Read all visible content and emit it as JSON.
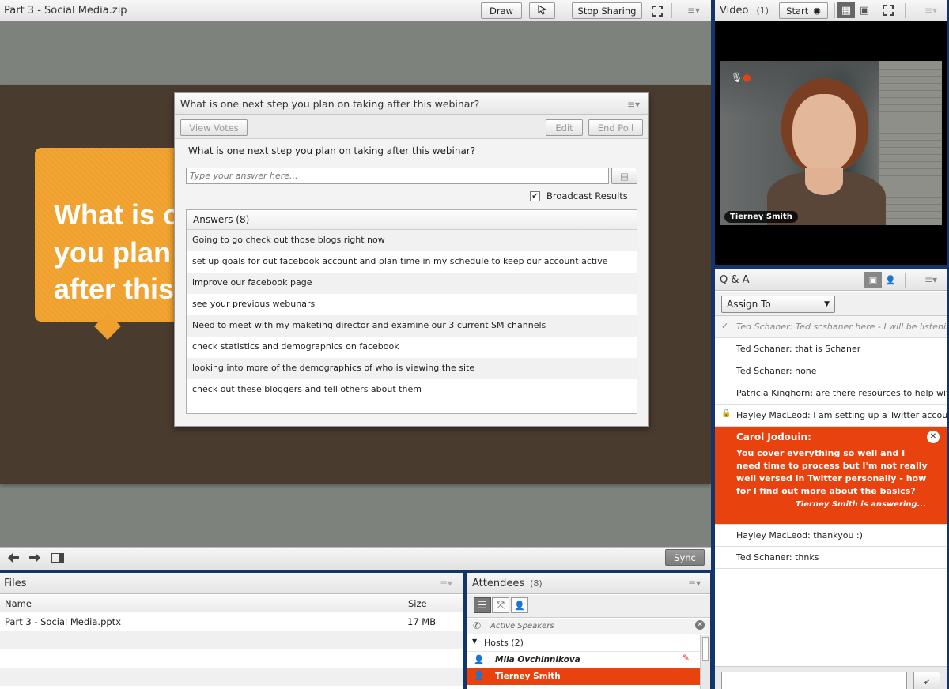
{
  "share": {
    "title": "Part 3 - Social Media.zip",
    "draw_label": "Draw",
    "stop_sharing_label": "Stop Sharing",
    "sync_label": "Sync",
    "slide_text_lines": [
      "What is o",
      "you plan",
      "after this"
    ]
  },
  "poll": {
    "window_title": "What is one next step you plan on taking after this webinar?",
    "view_votes_label": "View Votes",
    "edit_label": "Edit",
    "end_poll_label": "End Poll",
    "question": "What is one next step you plan on taking after this webinar?",
    "answer_placeholder": "Type your answer here...",
    "broadcast_label": "Broadcast Results",
    "broadcast_checked": true,
    "answers_header": "Answers (8)",
    "answers": [
      "Going to go check out those blogs right now",
      "set up goals for out facebook account and plan time in my schedule to keep our account active",
      "improve our facebook page",
      "see your previous webunars",
      "Need to meet with  my maketing director and examine our 3 current SM channels",
      "check statistics and demographics on facebook",
      "looking into more of the demographics of who is viewing the site",
      "check out these bloggers and tell others about them"
    ]
  },
  "video": {
    "title": "Video",
    "count": "(1)",
    "start_label": "Start",
    "name_tag": "Tierney Smith"
  },
  "qa": {
    "title": "Q & A",
    "assign_label": "Assign To",
    "items": [
      {
        "text": "Ted Schaner: Ted scshaner here - I will be listenin...",
        "answered": true
      },
      {
        "text": "Ted Schaner: that is Schaner"
      },
      {
        "text": "Ted Schaner: none"
      },
      {
        "text": "Patricia Kinghorn: are there resources to help wit..."
      },
      {
        "text": "Hayley MacLeod: I am setting up a Twitter accoun...",
        "locked": true
      }
    ],
    "selected": {
      "author": "Carol Jodouin:",
      "question": "You cover everything so well and I need time to process but I'm not really well versed in Twitter personally - how for I find out more about the basics?",
      "status": "Tierney Smith is answering..."
    },
    "items_after": [
      {
        "text": "Hayley MacLeod: thankyou :)"
      },
      {
        "text": "Ted Schaner: thnks"
      }
    ]
  },
  "files": {
    "title": "Files",
    "col_name": "Name",
    "col_size": "Size",
    "rows": [
      {
        "name": "Part 3 - Social Media.pptx",
        "size": "17 MB"
      }
    ]
  },
  "attendees": {
    "title": "Attendees",
    "count": "(8)",
    "active_speakers": "Active Speakers",
    "hosts_label": "Hosts (2)",
    "hosts": [
      "Mila Ovchinnikova",
      "Tierney Smith"
    ]
  },
  "colors": {
    "accent": "#e8420e",
    "frame": "#14356a",
    "slide_bg": "#4a3b2f",
    "slide_orange": "#f0a02c"
  }
}
